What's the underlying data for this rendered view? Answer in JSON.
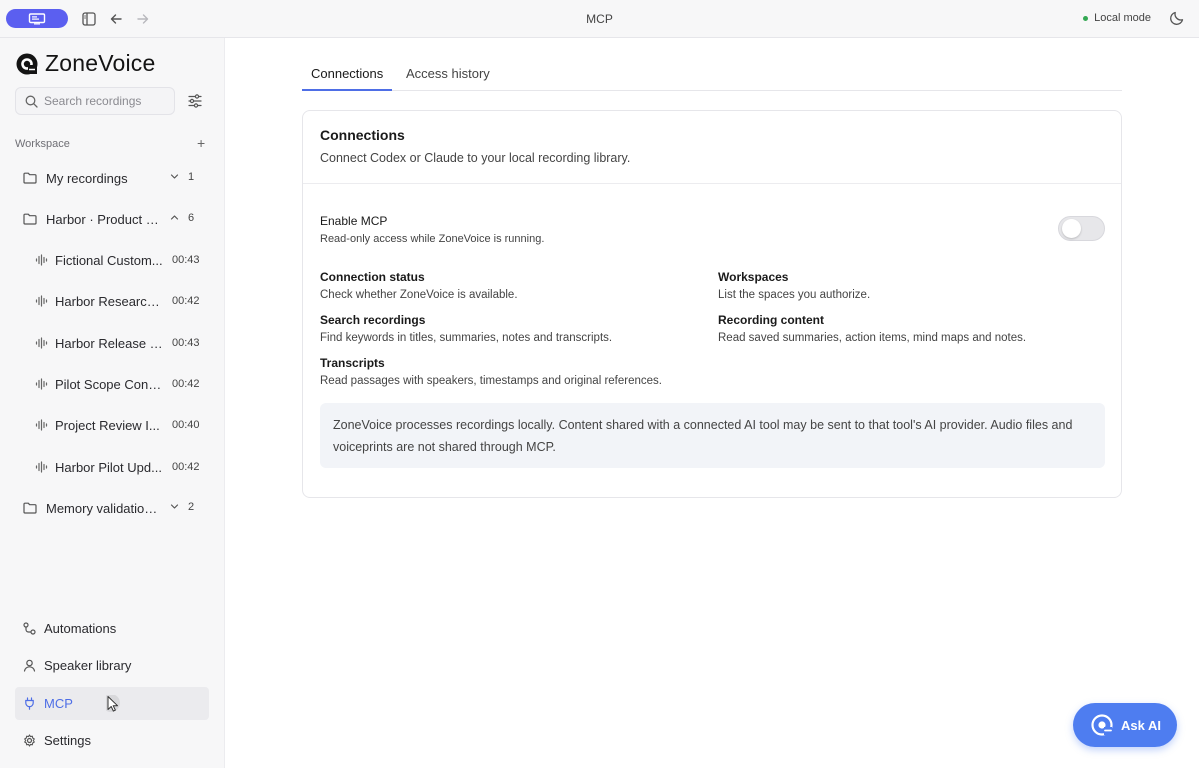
{
  "window": {
    "title": "MCP",
    "mode_label": "Local mode"
  },
  "brand": {
    "name": "ZoneVoice"
  },
  "sidebar": {
    "search_placeholder": "Search recordings",
    "workspace_label": "Workspace",
    "add_symbol": "+",
    "folders": [
      {
        "name": "My recordings",
        "count": "1",
        "expanded": false
      },
      {
        "name": "Harbor · Product c...",
        "count": "6",
        "expanded": true
      },
      {
        "name": "Memory validation ...",
        "count": "2",
        "expanded": false
      }
    ],
    "recordings": [
      {
        "name": "Fictional Custom...",
        "duration": "00:43"
      },
      {
        "name": "Harbor Research ...",
        "duration": "00:42"
      },
      {
        "name": "Harbor Release P...",
        "duration": "00:43"
      },
      {
        "name": "Pilot Scope Confi...",
        "duration": "00:42"
      },
      {
        "name": "Project Review I...",
        "duration": "00:40"
      },
      {
        "name": "Harbor Pilot Upd...",
        "duration": "00:42"
      }
    ],
    "nav": [
      {
        "label": "Automations",
        "icon": "automation-icon"
      },
      {
        "label": "Speaker library",
        "icon": "person-icon"
      },
      {
        "label": "MCP",
        "icon": "plug-icon",
        "active": true
      },
      {
        "label": "Settings",
        "icon": "gear-icon"
      }
    ]
  },
  "main": {
    "tabs": [
      {
        "label": "Connections",
        "active": true
      },
      {
        "label": "Access history",
        "active": false
      }
    ],
    "card": {
      "title": "Connections",
      "subtitle": "Connect Codex or Claude to your local recording library.",
      "enable": {
        "label": "Enable MCP",
        "desc": "Read-only access while ZoneVoice is running.",
        "on": false
      },
      "features": [
        {
          "title": "Connection status",
          "desc": "Check whether ZoneVoice is available."
        },
        {
          "title": "Workspaces",
          "desc": "List the spaces you authorize."
        },
        {
          "title": "Search recordings",
          "desc": "Find keywords in titles, summaries, notes and transcripts."
        },
        {
          "title": "Recording content",
          "desc": "Read saved summaries, action items, mind maps and notes."
        },
        {
          "title": "Transcripts",
          "desc": "Read passages with speakers, timestamps and original references."
        }
      ],
      "notice": "ZoneVoice processes recordings locally. Content shared with a connected AI tool may be sent to that tool's AI provider. Audio files and voiceprints are not shared through MCP."
    },
    "ask_ai_label": "Ask AI"
  },
  "colors": {
    "accent": "#4e6ee6",
    "pill": "#5b5ff0",
    "ask_ai": "#4e7df0",
    "status_dot": "#34a853"
  }
}
